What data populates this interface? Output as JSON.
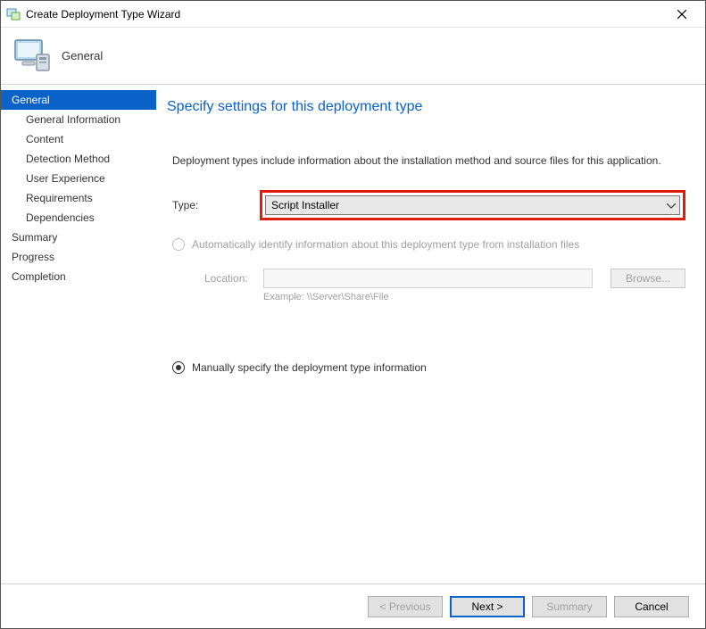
{
  "titlebar": {
    "title": "Create Deployment Type Wizard"
  },
  "header": {
    "section": "General"
  },
  "sidebar": {
    "items": [
      {
        "label": "General",
        "active": true,
        "sub": false
      },
      {
        "label": "General Information",
        "active": false,
        "sub": true
      },
      {
        "label": "Content",
        "active": false,
        "sub": true
      },
      {
        "label": "Detection Method",
        "active": false,
        "sub": true
      },
      {
        "label": "User Experience",
        "active": false,
        "sub": true
      },
      {
        "label": "Requirements",
        "active": false,
        "sub": true
      },
      {
        "label": "Dependencies",
        "active": false,
        "sub": true
      },
      {
        "label": "Summary",
        "active": false,
        "sub": false
      },
      {
        "label": "Progress",
        "active": false,
        "sub": false
      },
      {
        "label": "Completion",
        "active": false,
        "sub": false
      }
    ]
  },
  "content": {
    "heading": "Specify settings for this deployment type",
    "description": "Deployment types include information about the installation method and source files for this application.",
    "type_label": "Type:",
    "type_value": "Script Installer",
    "radio_auto": "Automatically identify information about this deployment type from installation files",
    "location_label": "Location:",
    "location_example": "Example: \\\\Server\\Share\\File",
    "browse": "Browse...",
    "radio_manual": "Manually specify the deployment type information"
  },
  "footer": {
    "previous": "< Previous",
    "next": "Next >",
    "summary": "Summary",
    "cancel": "Cancel"
  }
}
